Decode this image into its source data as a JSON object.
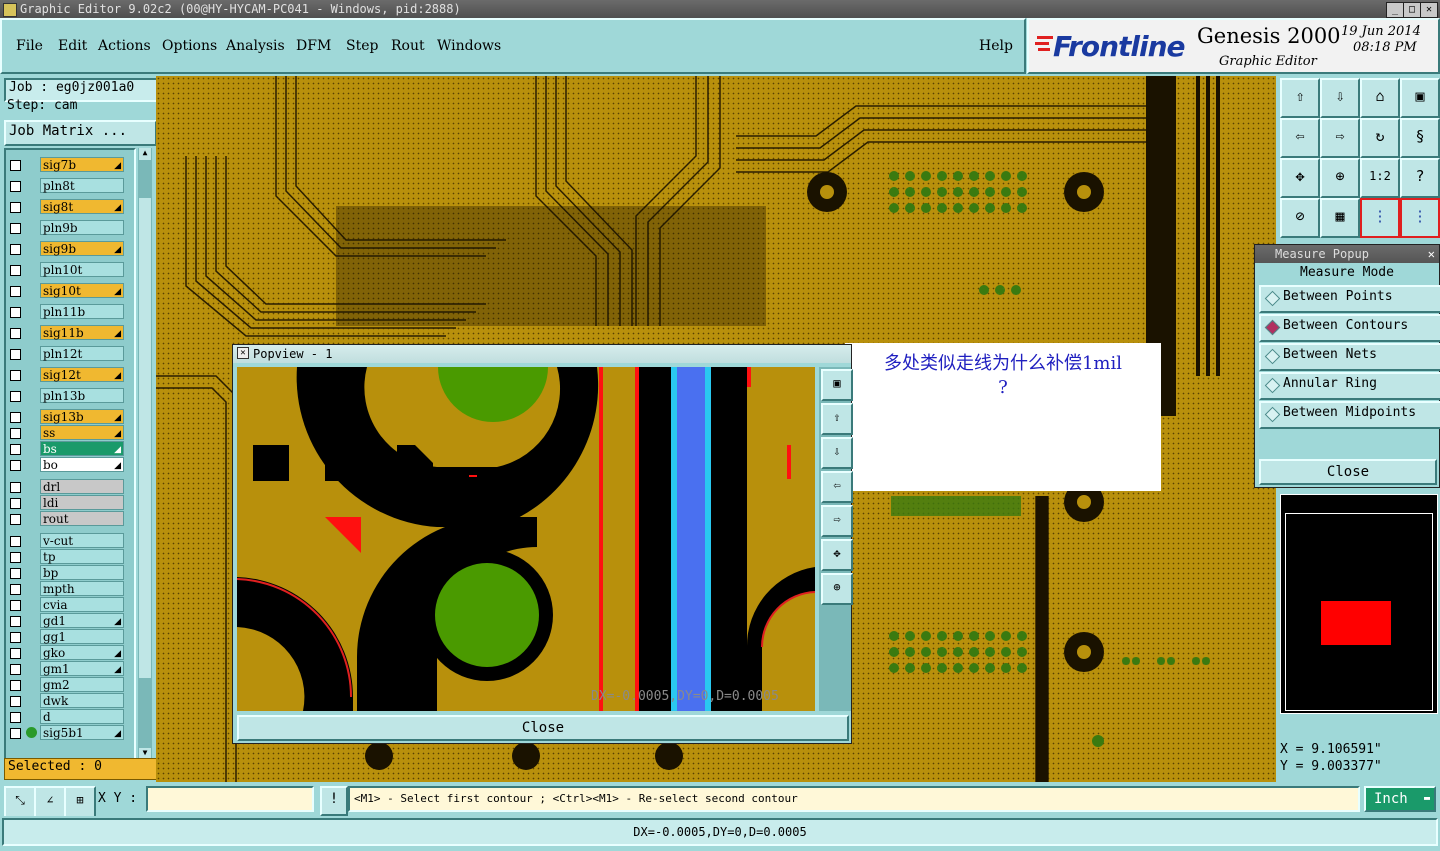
{
  "window": {
    "title": "Graphic Editor 9.02c2 (00@HY-HYCAM-PC041 - Windows, pid:2888)"
  },
  "menu": {
    "items": [
      "File",
      "Edit",
      "Actions",
      "Options",
      "Analysis",
      "DFM",
      "Step",
      "Rout",
      "Windows"
    ],
    "help": "Help"
  },
  "brand": {
    "logo": "Frontline",
    "product": "Genesis 2000",
    "subtitle": "Graphic Editor",
    "date": "19 Jun 2014",
    "time": "08:18 PM"
  },
  "job": {
    "job_line": "Job : eg0jz001a0",
    "step_line": "Step: cam",
    "matrix_button": "Job Matrix ..."
  },
  "layers": [
    {
      "name": "sig7b",
      "color": "#f0b830",
      "mark": "◢"
    },
    {
      "name": "pln8t",
      "color": "#a8e0e0",
      "mark": ""
    },
    {
      "name": "sig8t",
      "color": "#f0b830",
      "mark": "◢"
    },
    {
      "name": "pln9b",
      "color": "#a8e0e0",
      "mark": ""
    },
    {
      "name": "sig9b",
      "color": "#f0b830",
      "mark": "◢"
    },
    {
      "name": "pln10t",
      "color": "#a8e0e0",
      "mark": ""
    },
    {
      "name": "sig10t",
      "color": "#f0b830",
      "mark": "◢"
    },
    {
      "name": "pln11b",
      "color": "#a8e0e0",
      "mark": ""
    },
    {
      "name": "sig11b",
      "color": "#f0b830",
      "mark": "◢"
    },
    {
      "name": "pln12t",
      "color": "#a8e0e0",
      "mark": ""
    },
    {
      "name": "sig12t",
      "color": "#f0b830",
      "mark": "◢"
    },
    {
      "name": "pln13b",
      "color": "#a8e0e0",
      "mark": ""
    },
    {
      "name": "sig13b",
      "color": "#f0b830",
      "mark": "◢"
    },
    {
      "name": "ss",
      "color": "#f0b830",
      "mark": "◢"
    },
    {
      "name": "bs",
      "color": "#1a9a6a",
      "mark": "◢"
    },
    {
      "name": "bo",
      "color": "#ffffff",
      "mark": "◢"
    },
    {
      "name": "drl",
      "color": "#c8c8c8",
      "mark": ""
    },
    {
      "name": "ldi",
      "color": "#c8c8c8",
      "mark": ""
    },
    {
      "name": "rout",
      "color": "#c8c8c8",
      "mark": ""
    },
    {
      "name": "v-cut",
      "color": "#a8e0e0",
      "mark": ""
    },
    {
      "name": "tp",
      "color": "#a8e0e0",
      "mark": ""
    },
    {
      "name": "bp",
      "color": "#a8e0e0",
      "mark": ""
    },
    {
      "name": "mpth",
      "color": "#a8e0e0",
      "mark": ""
    },
    {
      "name": "cvia",
      "color": "#a8e0e0",
      "mark": ""
    },
    {
      "name": "gd1",
      "color": "#a8e0e0",
      "mark": "◢"
    },
    {
      "name": "gg1",
      "color": "#a8e0e0",
      "mark": ""
    },
    {
      "name": "gko",
      "color": "#a8e0e0",
      "mark": "◢"
    },
    {
      "name": "gm1",
      "color": "#a8e0e0",
      "mark": "◢"
    },
    {
      "name": "gm2",
      "color": "#a8e0e0",
      "mark": ""
    },
    {
      "name": "dwk",
      "color": "#a8e0e0",
      "mark": ""
    },
    {
      "name": "d",
      "color": "#a8e0e0",
      "mark": ""
    },
    {
      "name": "sig5b1",
      "color": "#a8e0e0",
      "mark": "◢"
    }
  ],
  "selected": "Selected : 0",
  "popview": {
    "title": "Popview - 1",
    "readout": "DX=-0.0005,DY=0,D=0.0005",
    "close": "Close"
  },
  "annotation": {
    "line1": "多处类似走线为什么补偿1mil",
    "line2": "?"
  },
  "measure": {
    "title": "Measure Popup",
    "header": "Measure Mode",
    "options": [
      {
        "label": "Between Points",
        "selected": false
      },
      {
        "label": "Between Contours",
        "selected": true
      },
      {
        "label": "Between Nets",
        "selected": false
      },
      {
        "label": "Annular Ring",
        "selected": false
      },
      {
        "label": "Between Midpoints",
        "selected": false
      }
    ],
    "close": "Close"
  },
  "coords": {
    "x": "X = 9.106591\"",
    "y": "Y = 9.003377\""
  },
  "cmdbar": {
    "xy_label": "X Y :",
    "prompt": "<M1> - Select first contour ; <Ctrl><M1> - Re-select second contour",
    "units": "Inch"
  },
  "status": {
    "text": "DX=-0.0005,DY=0,D=0.0005"
  },
  "colors": {
    "copper": "#b8900c",
    "panel": "#9fd8d8",
    "pad_green": "#4a9a00",
    "highlight_blue": "#4a70f0"
  }
}
